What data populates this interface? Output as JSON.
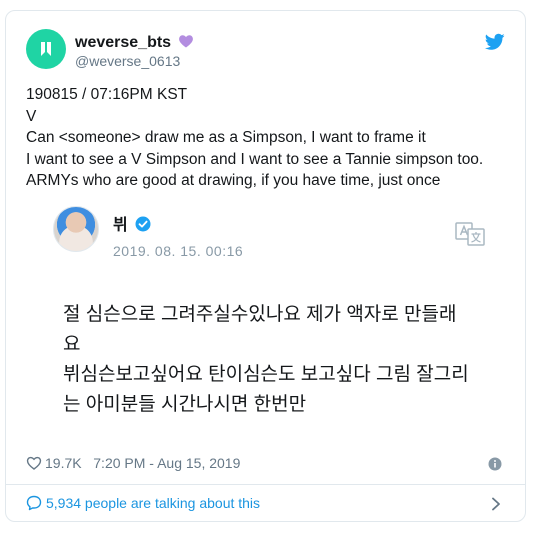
{
  "tweet": {
    "author": {
      "name": "weverse_bts",
      "handle": "@weverse_0613"
    },
    "text": "190815 / 07:16PM KST\nV\nCan <someone> draw me as a Simpson, I want to frame it\nI want to see a V Simpson and I want to see a Tannie simpson too.\nARMYs who are good at drawing, if you have time, just once",
    "quoted": {
      "name": "뷔",
      "timestamp": "2019. 08. 15. 00:16",
      "text": "절 심슨으로 그려주실수있나요 제가 액자로 만들래\n요\n뷔심슨보고싶어요 탄이심슨도 보고싶다 그림 잘그리\n는 아미분들 시간나시면 한번만"
    },
    "likes": "19.7K",
    "posted_at": "7:20 PM - Aug 15, 2019",
    "footer": {
      "talking": "5,934 people are talking about this"
    }
  },
  "colors": {
    "brand_blue": "#1da1f2",
    "verified_blue": "#1da1f2",
    "weverse_green": "#1fd4a4",
    "heart_purple": "#b38de0"
  },
  "icons": [
    "weverse-logo-icon",
    "purple-heart-icon",
    "twitter-bird-icon",
    "verified-badge-icon",
    "translate-icon",
    "heart-outline-icon",
    "info-icon",
    "speech-bubble-icon",
    "chevron-right-icon"
  ]
}
